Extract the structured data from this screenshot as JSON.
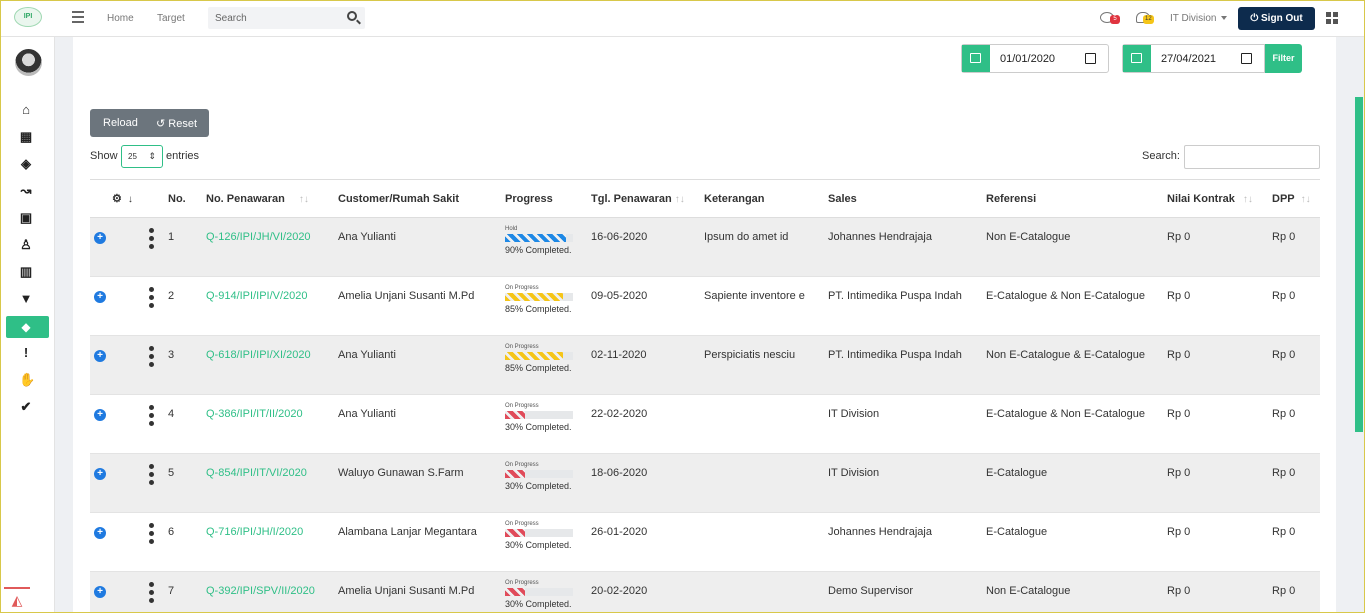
{
  "topbar": {
    "logo_text": "IPI",
    "nav": [
      "Home",
      "Target"
    ],
    "search_placeholder": "Search",
    "notif_messages": "5",
    "notif_alerts": "12",
    "org": "IT Division",
    "signout": "Sign Out"
  },
  "colors": {
    "accent": "#2fbf87",
    "signout": "#0d2b4d",
    "link": "#2fbf87",
    "hold": "#1e88e5",
    "on_progress_high": "#f5c518",
    "on_progress_low": "#e04b5a"
  },
  "filter": {
    "date_from": "01/01/2020",
    "date_to": "27/04/2021",
    "button": "Filter"
  },
  "toolbar": {
    "reload": "Reload",
    "reset": "Reset"
  },
  "length": {
    "show": "Show",
    "value": "25",
    "entries": "entries"
  },
  "search": {
    "label": "Search:"
  },
  "table": {
    "headers": {
      "no": "No.",
      "penawaran": "No. Penawaran",
      "customer": "Customer/Rumah Sakit",
      "progress": "Progress",
      "tgl": "Tgl. Penawaran",
      "ket": "Keterangan",
      "sales": "Sales",
      "ref": "Referensi",
      "nilai": "Nilai Kontrak",
      "dpp": "DPP"
    },
    "rows": [
      {
        "no": "1",
        "penawaran": "Q-126/IPI/JH/VI/2020",
        "customer": "Ana Yulianti",
        "status": "Hold",
        "progress": 0.9,
        "pct": "90% Completed.",
        "tgl": "16-06-2020",
        "ket": "Ipsum do amet id",
        "sales": "Johannes Hendrajaja",
        "ref": "Non E-Catalogue",
        "nilai": "Rp 0",
        "dpp": "Rp 0"
      },
      {
        "no": "2",
        "penawaran": "Q-914/IPI/IPI/V/2020",
        "customer": "Amelia Unjani Susanti M.Pd",
        "status": "On Progress",
        "progress": 0.85,
        "pct": "85% Completed.",
        "tgl": "09-05-2020",
        "ket": "Sapiente inventore e",
        "sales": "PT. Intimedika Puspa Indah",
        "ref": "E-Catalogue & Non E-Catalogue",
        "nilai": "Rp 0",
        "dpp": "Rp 0"
      },
      {
        "no": "3",
        "penawaran": "Q-618/IPI/IPI/XI/2020",
        "customer": "Ana Yulianti",
        "status": "On Progress",
        "progress": 0.85,
        "pct": "85% Completed.",
        "tgl": "02-11-2020",
        "ket": "Perspiciatis nesciu",
        "sales": "PT. Intimedika Puspa Indah",
        "ref": "Non E-Catalogue & E-Catalogue",
        "nilai": "Rp 0",
        "dpp": "Rp 0"
      },
      {
        "no": "4",
        "penawaran": "Q-386/IPI/IT/II/2020",
        "customer": "Ana Yulianti",
        "status": "On Progress",
        "progress": 0.3,
        "pct": "30% Completed.",
        "tgl": "22-02-2020",
        "ket": "",
        "sales": "IT Division",
        "ref": "E-Catalogue & Non E-Catalogue",
        "nilai": "Rp 0",
        "dpp": "Rp 0"
      },
      {
        "no": "5",
        "penawaran": "Q-854/IPI/IT/VI/2020",
        "customer": "Waluyo Gunawan S.Farm",
        "status": "On Progress",
        "progress": 0.3,
        "pct": "30% Completed.",
        "tgl": "18-06-2020",
        "ket": "",
        "sales": "IT Division",
        "ref": "E-Catalogue",
        "nilai": "Rp 0",
        "dpp": "Rp 0"
      },
      {
        "no": "6",
        "penawaran": "Q-716/IPI/JH/I/2020",
        "customer": "Alambana Lanjar Megantara",
        "status": "On Progress",
        "progress": 0.3,
        "pct": "30% Completed.",
        "tgl": "26-01-2020",
        "ket": "",
        "sales": "Johannes Hendrajaja",
        "ref": "E-Catalogue",
        "nilai": "Rp 0",
        "dpp": "Rp 0"
      },
      {
        "no": "7",
        "penawaran": "Q-392/IPI/SPV/II/2020",
        "customer": "Amelia Unjani Susanti M.Pd",
        "status": "On Progress",
        "progress": 0.3,
        "pct": "30% Completed.",
        "tgl": "20-02-2020",
        "ket": "",
        "sales": "Demo Supervisor",
        "ref": "Non E-Catalogue",
        "nilai": "Rp 0",
        "dpp": "Rp 0"
      }
    ]
  }
}
